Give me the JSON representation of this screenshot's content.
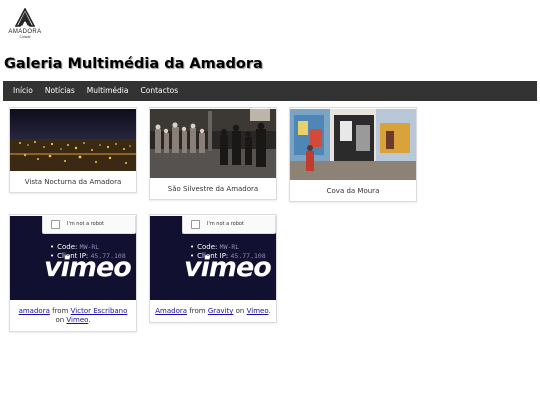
{
  "logo": {
    "name": "AMADORA",
    "sub": "Cidade"
  },
  "page_title": "Galeria Multimédia da Amadora",
  "nav": [
    {
      "label": "Início"
    },
    {
      "label": "Notícias"
    },
    {
      "label": "Multimédia"
    },
    {
      "label": "Contactos"
    }
  ],
  "gallery": [
    {
      "caption": "Vista Nocturna da Amadora"
    },
    {
      "caption": "São Silvestre da Amadora"
    },
    {
      "caption": "Cova da Moura"
    }
  ],
  "videos": [
    {
      "captcha_label": "I'm not a robot",
      "code_label": "Code:",
      "code_value": "MW-RL",
      "ip_label": "Client IP:",
      "ip_value": "45.77.108",
      "brand_word": "vimeo",
      "link_title": "amadora",
      "from_text": "from",
      "author": "Victor Escribano",
      "on_text": "on",
      "platform": "Vimeo",
      "end_punct": "."
    },
    {
      "captcha_label": "I'm not a robot",
      "code_label": "Code:",
      "code_value": "MW-RL",
      "ip_label": "Client IP:",
      "ip_value": "45.77.108",
      "brand_word": "vimeo",
      "link_title": "Amadora",
      "from_text": "from",
      "author": "Gravity",
      "on_text": "on",
      "platform": "Vimeo",
      "end_punct": "."
    }
  ],
  "colors": {
    "navbar": "#333333",
    "link": "#1a0dab",
    "video_bg": "#121030"
  }
}
